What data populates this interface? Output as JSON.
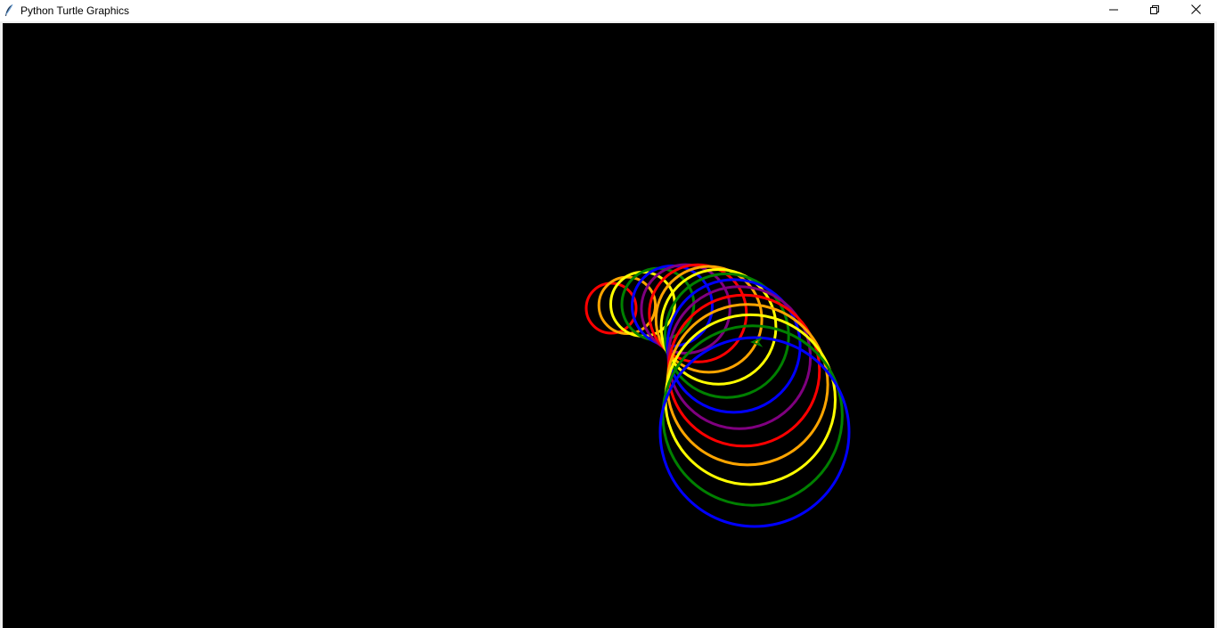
{
  "window": {
    "title": "Python Turtle Graphics",
    "app_icon": "feather-icon",
    "controls": {
      "minimize_icon": "minimize-icon",
      "restore_icon": "restore-icon",
      "close_icon": "close-icon"
    }
  },
  "canvas": {
    "background": "#000000",
    "pen_width": 3,
    "color_cycle": [
      "#ff0000",
      "#ffa500",
      "#ffff00",
      "#008000",
      "#0000ff",
      "#800080"
    ],
    "circle_count": 17,
    "turtle_color": "#008000"
  }
}
